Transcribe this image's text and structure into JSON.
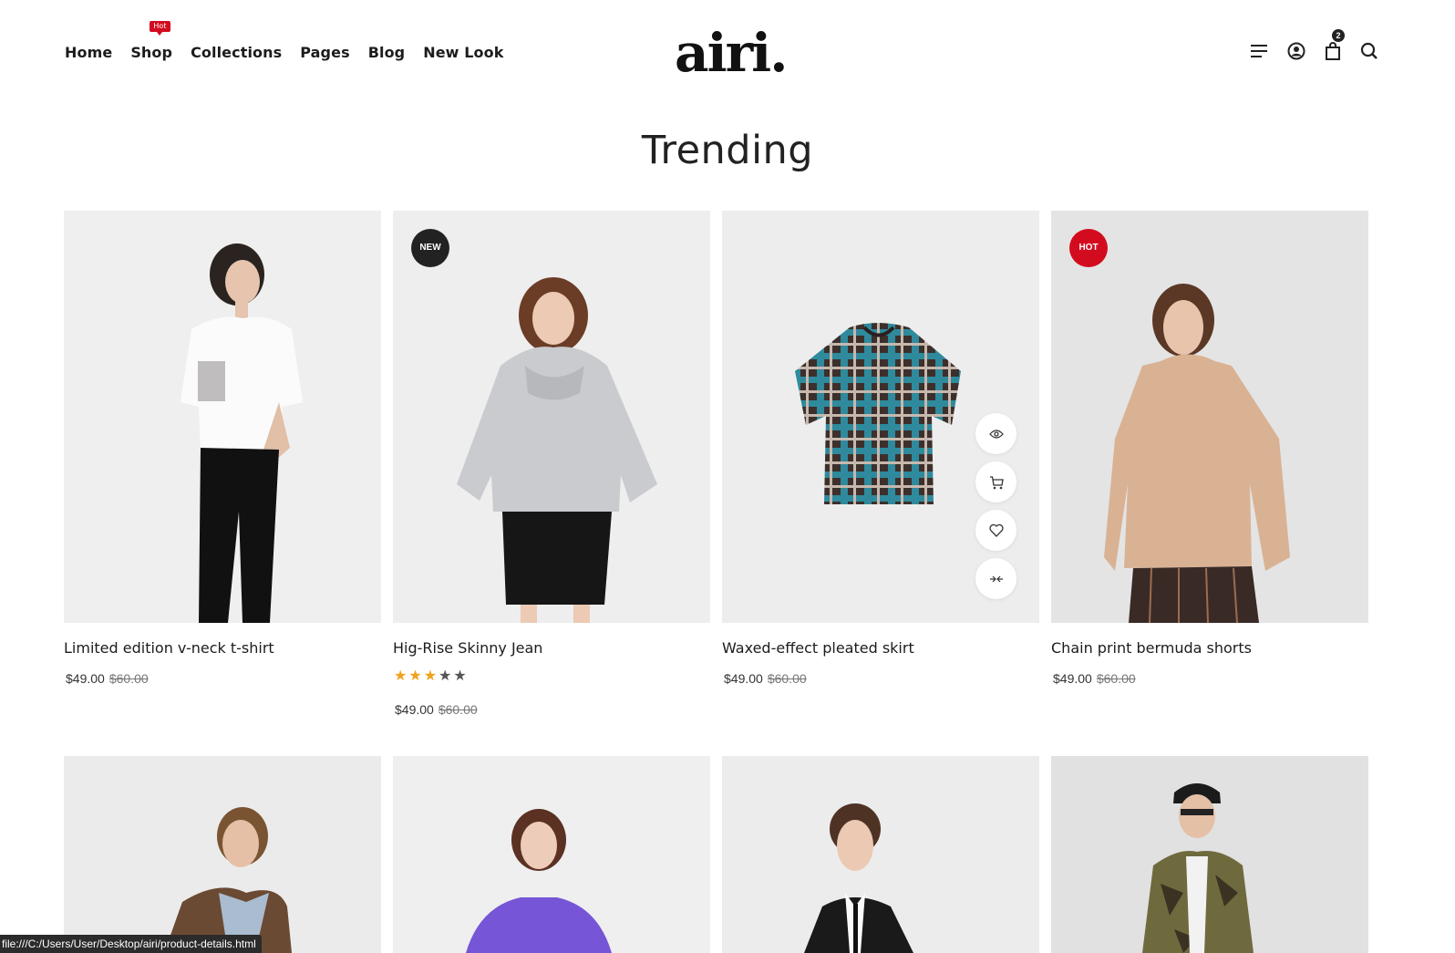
{
  "nav": {
    "items": [
      "Home",
      "Shop",
      "Collections",
      "Pages",
      "Blog",
      "New Look"
    ],
    "shop_flag": "Hot"
  },
  "logo": "airi.",
  "header_icons": {
    "menu": "menu-lines-icon",
    "account": "user-circle-icon",
    "cart": "shopping-bag-icon",
    "cart_count": "2",
    "search": "search-icon"
  },
  "section_title": "Trending",
  "products_row1": [
    {
      "name": "Limited edition v-neck t-shirt",
      "price": "$49.00",
      "old_price": "$60.00",
      "badge": "",
      "rating": null
    },
    {
      "name": "Hig-Rise Skinny Jean",
      "price": "$49.00",
      "old_price": "$60.00",
      "badge": "NEW",
      "rating": 3
    },
    {
      "name": "Waxed-effect pleated skirt",
      "price": "$49.00",
      "old_price": "$60.00",
      "badge": "",
      "rating": null
    },
    {
      "name": "Chain print bermuda shorts",
      "price": "$49.00",
      "old_price": "$60.00",
      "badge": "HOT",
      "rating": null
    }
  ],
  "rating_max": 5,
  "hover_actions": [
    "eye-icon",
    "cart-icon",
    "heart-icon",
    "compare-icon"
  ],
  "colors": {
    "accent": "#d30b1e",
    "dark": "#222222",
    "star": "#f0a21b",
    "image_bg": "#ececec"
  },
  "status_url": "file:///C:/Users/User/Desktop/airi/product-details.html"
}
